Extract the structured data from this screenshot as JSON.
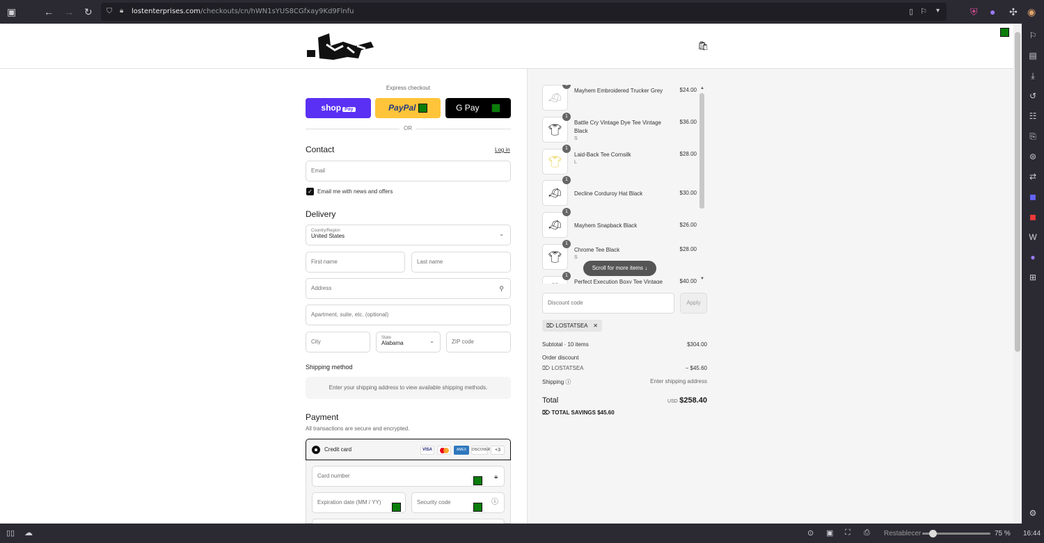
{
  "browser": {
    "url_domain": "lostenterprises.com",
    "url_path": "/checkouts/cn/hWN1sYUS8CGfxay9Kd9Flnfu"
  },
  "header": {
    "logo": "lost"
  },
  "express": {
    "label": "Express checkout",
    "shop_label": "shop",
    "shop_pay_tag": "Pay",
    "paypal_label": "PayPal",
    "gpay_label": "G Pay",
    "or_label": "OR"
  },
  "contact": {
    "title": "Contact",
    "login_link": "Log in",
    "email_placeholder": "Email",
    "newsletter_label": "Email me with news and offers"
  },
  "delivery": {
    "title": "Delivery",
    "country_label": "Country/Region",
    "country_value": "United States",
    "first_name": "First name",
    "last_name": "Last name",
    "address": "Address",
    "apartment": "Apartment, suite, etc. (optional)",
    "city": "City",
    "state_label": "State",
    "state_value": "Alabama",
    "zip": "ZIP code"
  },
  "shipping_method": {
    "title": "Shipping method",
    "message": "Enter your shipping address to view available shipping methods."
  },
  "payment": {
    "title": "Payment",
    "subtitle": "All transactions are secure and encrypted.",
    "method": "Credit card",
    "card_logos": [
      "VISA",
      "MC",
      "AMEX",
      "DISCOVER"
    ],
    "more_cards": "+3",
    "card_number": "Card number",
    "expiration": "Expiration date (MM / YY)",
    "security": "Security code"
  },
  "cart": {
    "items": [
      {
        "name": "Mayhem Embroidered Trucker Grey",
        "variant": "",
        "price": "$24.00",
        "qty": "1",
        "icon": "cap-icon"
      },
      {
        "name": "Battle Cry Vintage Dye Tee Vintage Black",
        "variant": "S",
        "price": "$36.00",
        "qty": "1",
        "icon": "tshirt-icon"
      },
      {
        "name": "Laid-Back Tee Cornsilk",
        "variant": "L",
        "price": "$28.00",
        "qty": "1",
        "icon": "tshirt-icon"
      },
      {
        "name": "Decline Corduroy Hat Black",
        "variant": "",
        "price": "$30.00",
        "qty": "1",
        "icon": "cap-icon"
      },
      {
        "name": "Mayhem Snapback Black",
        "variant": "",
        "price": "$26.00",
        "qty": "1",
        "icon": "cap-icon"
      },
      {
        "name": "Chrome Tee Black",
        "variant": "S",
        "price": "$28.00",
        "qty": "1",
        "icon": "tshirt-icon"
      },
      {
        "name": "Perfect Execution Boxy Tee Vintage",
        "variant": "",
        "price": "$40.00",
        "qty": "1",
        "icon": "tshirt-icon"
      }
    ],
    "scroll_hint": "Scroll for more items",
    "discount_placeholder": "Discount code",
    "apply_label": "Apply",
    "discount_tag": "LOSTATSEA",
    "subtotal_label": "Subtotal · 10 items",
    "subtotal_value": "$304.00",
    "order_discount_label": "Order discount",
    "discount_code": "LOSTATSEA",
    "discount_value": "− $45.60",
    "shipping_label": "Shipping",
    "shipping_value": "Enter shipping address",
    "total_label": "Total",
    "currency": "USD",
    "total_value": "$258.40",
    "savings_label": "TOTAL SAVINGS",
    "savings_value": "$45.60"
  },
  "status": {
    "reset_label": "Restablecer",
    "zoom": "75 %",
    "time": "16:44"
  },
  "colors": {
    "shop": "#5a31f4",
    "paypal": "#ffc439",
    "gpay": "#000000",
    "accent": "#1a1a1a"
  }
}
